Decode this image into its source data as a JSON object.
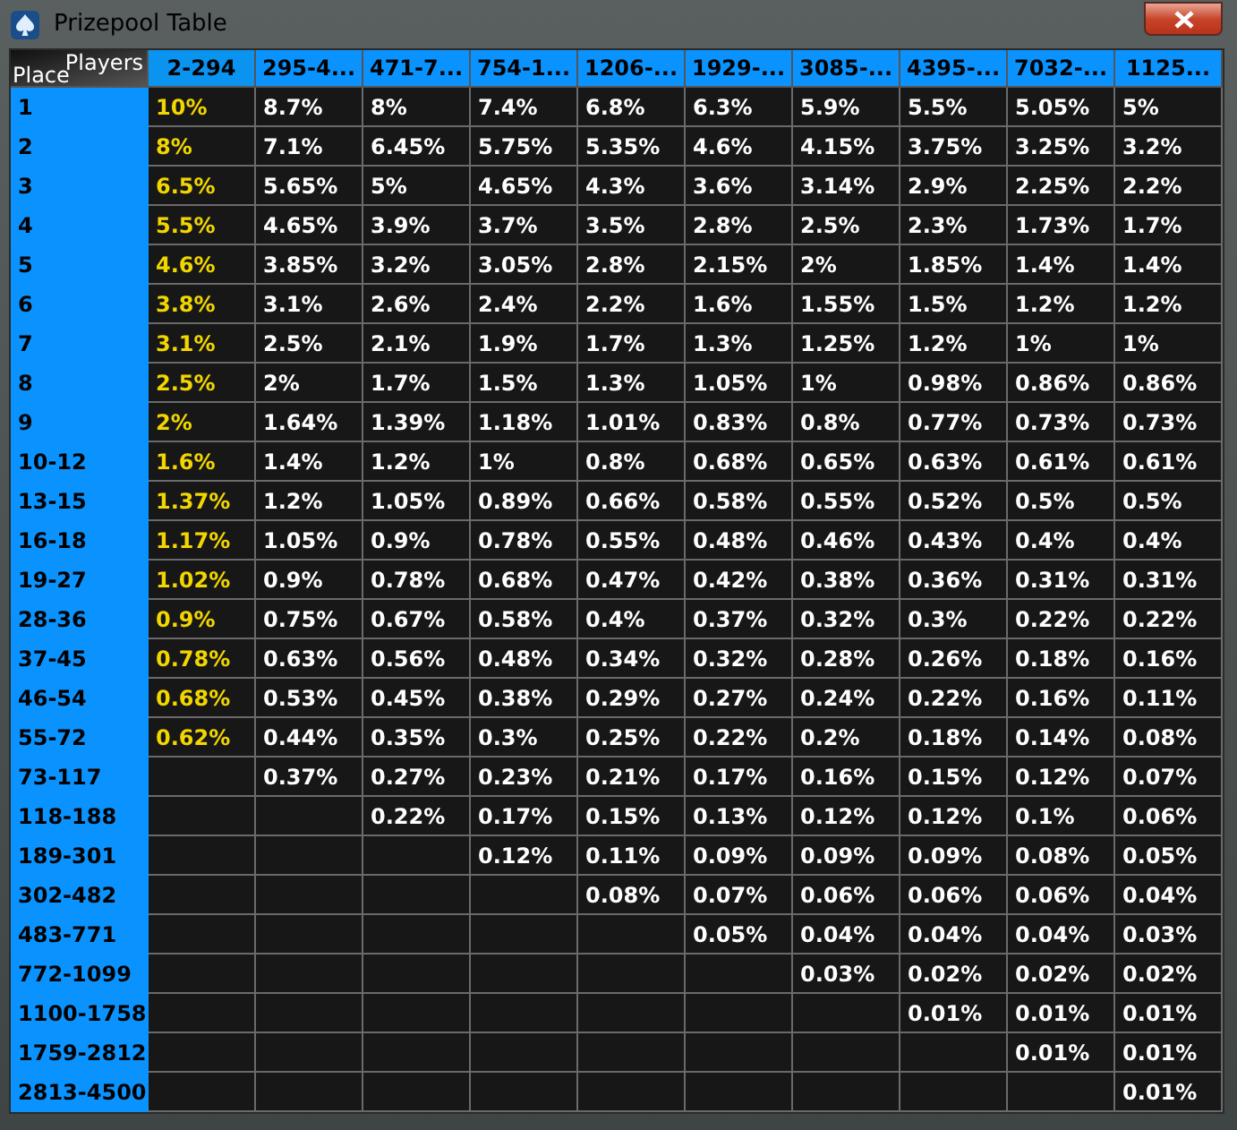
{
  "window": {
    "title": "Prizepool Table"
  },
  "table": {
    "corner": {
      "column_label": "Players",
      "row_label": "Place"
    },
    "columns": [
      {
        "label": "2-294",
        "selected": true
      },
      {
        "label": "295-4...",
        "selected": false
      },
      {
        "label": "471-7...",
        "selected": false
      },
      {
        "label": "754-1...",
        "selected": false
      },
      {
        "label": "1206-...",
        "selected": false
      },
      {
        "label": "1929-...",
        "selected": false
      },
      {
        "label": "3085-...",
        "selected": false
      },
      {
        "label": "4395-...",
        "selected": false
      },
      {
        "label": "7032-...",
        "selected": false
      },
      {
        "label": "1125...",
        "selected": false
      }
    ],
    "rows": [
      {
        "place": "1",
        "cells": [
          "10%",
          "8.7%",
          "8%",
          "7.4%",
          "6.8%",
          "6.3%",
          "5.9%",
          "5.5%",
          "5.05%",
          "5%"
        ]
      },
      {
        "place": "2",
        "cells": [
          "8%",
          "7.1%",
          "6.45%",
          "5.75%",
          "5.35%",
          "4.6%",
          "4.15%",
          "3.75%",
          "3.25%",
          "3.2%"
        ]
      },
      {
        "place": "3",
        "cells": [
          "6.5%",
          "5.65%",
          "5%",
          "4.65%",
          "4.3%",
          "3.6%",
          "3.14%",
          "2.9%",
          "2.25%",
          "2.2%"
        ]
      },
      {
        "place": "4",
        "cells": [
          "5.5%",
          "4.65%",
          "3.9%",
          "3.7%",
          "3.5%",
          "2.8%",
          "2.5%",
          "2.3%",
          "1.73%",
          "1.7%"
        ]
      },
      {
        "place": "5",
        "cells": [
          "4.6%",
          "3.85%",
          "3.2%",
          "3.05%",
          "2.8%",
          "2.15%",
          "2%",
          "1.85%",
          "1.4%",
          "1.4%"
        ]
      },
      {
        "place": "6",
        "cells": [
          "3.8%",
          "3.1%",
          "2.6%",
          "2.4%",
          "2.2%",
          "1.6%",
          "1.55%",
          "1.5%",
          "1.2%",
          "1.2%"
        ]
      },
      {
        "place": "7",
        "cells": [
          "3.1%",
          "2.5%",
          "2.1%",
          "1.9%",
          "1.7%",
          "1.3%",
          "1.25%",
          "1.2%",
          "1%",
          "1%"
        ]
      },
      {
        "place": "8",
        "cells": [
          "2.5%",
          "2%",
          "1.7%",
          "1.5%",
          "1.3%",
          "1.05%",
          "1%",
          "0.98%",
          "0.86%",
          "0.86%"
        ]
      },
      {
        "place": "9",
        "cells": [
          "2%",
          "1.64%",
          "1.39%",
          "1.18%",
          "1.01%",
          "0.83%",
          "0.8%",
          "0.77%",
          "0.73%",
          "0.73%"
        ]
      },
      {
        "place": "10-12",
        "cells": [
          "1.6%",
          "1.4%",
          "1.2%",
          "1%",
          "0.8%",
          "0.68%",
          "0.65%",
          "0.63%",
          "0.61%",
          "0.61%"
        ]
      },
      {
        "place": "13-15",
        "cells": [
          "1.37%",
          "1.2%",
          "1.05%",
          "0.89%",
          "0.66%",
          "0.58%",
          "0.55%",
          "0.52%",
          "0.5%",
          "0.5%"
        ]
      },
      {
        "place": "16-18",
        "cells": [
          "1.17%",
          "1.05%",
          "0.9%",
          "0.78%",
          "0.55%",
          "0.48%",
          "0.46%",
          "0.43%",
          "0.4%",
          "0.4%"
        ]
      },
      {
        "place": "19-27",
        "cells": [
          "1.02%",
          "0.9%",
          "0.78%",
          "0.68%",
          "0.47%",
          "0.42%",
          "0.38%",
          "0.36%",
          "0.31%",
          "0.31%"
        ]
      },
      {
        "place": "28-36",
        "cells": [
          "0.9%",
          "0.75%",
          "0.67%",
          "0.58%",
          "0.4%",
          "0.37%",
          "0.32%",
          "0.3%",
          "0.22%",
          "0.22%"
        ]
      },
      {
        "place": "37-45",
        "cells": [
          "0.78%",
          "0.63%",
          "0.56%",
          "0.48%",
          "0.34%",
          "0.32%",
          "0.28%",
          "0.26%",
          "0.18%",
          "0.16%"
        ]
      },
      {
        "place": "46-54",
        "cells": [
          "0.68%",
          "0.53%",
          "0.45%",
          "0.38%",
          "0.29%",
          "0.27%",
          "0.24%",
          "0.22%",
          "0.16%",
          "0.11%"
        ]
      },
      {
        "place": "55-72",
        "cells": [
          "0.62%",
          "0.44%",
          "0.35%",
          "0.3%",
          "0.25%",
          "0.22%",
          "0.2%",
          "0.18%",
          "0.14%",
          "0.08%"
        ]
      },
      {
        "place": "73-117",
        "cells": [
          null,
          "0.37%",
          "0.27%",
          "0.23%",
          "0.21%",
          "0.17%",
          "0.16%",
          "0.15%",
          "0.12%",
          "0.07%"
        ]
      },
      {
        "place": "118-188",
        "cells": [
          null,
          null,
          "0.22%",
          "0.17%",
          "0.15%",
          "0.13%",
          "0.12%",
          "0.12%",
          "0.1%",
          "0.06%"
        ]
      },
      {
        "place": "189-301",
        "cells": [
          null,
          null,
          null,
          "0.12%",
          "0.11%",
          "0.09%",
          "0.09%",
          "0.09%",
          "0.08%",
          "0.05%"
        ]
      },
      {
        "place": "302-482",
        "cells": [
          null,
          null,
          null,
          null,
          "0.08%",
          "0.07%",
          "0.06%",
          "0.06%",
          "0.06%",
          "0.04%"
        ]
      },
      {
        "place": "483-771",
        "cells": [
          null,
          null,
          null,
          null,
          null,
          "0.05%",
          "0.04%",
          "0.04%",
          "0.04%",
          "0.03%"
        ]
      },
      {
        "place": "772-1099",
        "cells": [
          null,
          null,
          null,
          null,
          null,
          null,
          "0.03%",
          "0.02%",
          "0.02%",
          "0.02%"
        ]
      },
      {
        "place": "1100-1758",
        "cells": [
          null,
          null,
          null,
          null,
          null,
          null,
          null,
          "0.01%",
          "0.01%",
          "0.01%"
        ]
      },
      {
        "place": "1759-2812",
        "cells": [
          null,
          null,
          null,
          null,
          null,
          null,
          null,
          null,
          "0.01%",
          "0.01%"
        ]
      },
      {
        "place": "2813-4500",
        "cells": [
          null,
          null,
          null,
          null,
          null,
          null,
          null,
          null,
          null,
          "0.01%"
        ]
      }
    ]
  }
}
